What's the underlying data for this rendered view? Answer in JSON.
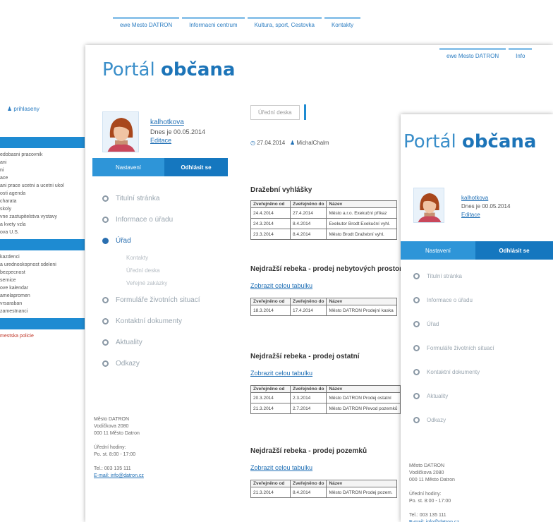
{
  "back_window": {
    "top_nav": [
      "ewe Mesto DATRON",
      "Informacni centrum",
      "Kultura, sport, Cestovka",
      "Kontakty"
    ],
    "user_label": "prihlaseny",
    "left_menu": [
      {
        "type": "bar"
      },
      {
        "type": "line",
        "text": "edobasni pracovnik"
      },
      {
        "type": "line",
        "text": "ani"
      },
      {
        "type": "line",
        "text": "ni"
      },
      {
        "type": "line",
        "text": "ace"
      },
      {
        "type": "line",
        "text": "ani prace ucetni a ucetni ukol"
      },
      {
        "type": "line",
        "text": "osti agenda"
      },
      {
        "type": "line",
        "text": "charata"
      },
      {
        "type": "line",
        "text": "skoly"
      },
      {
        "type": "line",
        "text": "vne zastupitelstva vystavy"
      },
      {
        "type": "line",
        "text": "a kvety vzla"
      },
      {
        "type": "line",
        "text": "ova U.S."
      },
      {
        "type": "bar"
      },
      {
        "type": "line",
        "text": "kazdenci"
      },
      {
        "type": "line",
        "text": "a urednoskopnost sdeleni"
      },
      {
        "type": "line",
        "text": "bezpecnost"
      },
      {
        "type": "line",
        "text": "sernice"
      },
      {
        "type": "line",
        "text": "ove kalendar"
      },
      {
        "type": "line",
        "text": "amelapromen"
      },
      {
        "type": "line",
        "text": "vrsaraban"
      },
      {
        "type": "line",
        "text": "zamestnanci"
      },
      {
        "type": "bar"
      },
      {
        "type": "line",
        "text": "mestska policie",
        "link": true
      }
    ]
  },
  "portal_title_light": "Portál ",
  "portal_title_bold": "občana",
  "mid_window": {
    "top_nav": [
      "ewe Mesto DATRON",
      "Info"
    ],
    "user": {
      "name": "kalhotkova",
      "date": "Dnes je 00.05.2014",
      "link": "Editace"
    },
    "tabs": {
      "left": "Nastavení",
      "right": "Odhlásit se"
    },
    "nav": [
      {
        "label": "Titulní stránka",
        "active": false
      },
      {
        "label": "Informace o úřadu",
        "active": false
      },
      {
        "label": "Úřad",
        "active": true
      },
      {
        "sub": "Kontakty"
      },
      {
        "sub": "Úřední deska"
      },
      {
        "sub": "Veřejné zakázky"
      },
      {
        "label": "Formuláře životních situací",
        "active": false
      },
      {
        "label": "Kontaktní dokumenty",
        "active": false
      },
      {
        "label": "Aktuality",
        "active": false
      },
      {
        "label": "Odkazy",
        "active": false
      }
    ],
    "address": [
      "Město DATRON",
      "Vodičkova 2080",
      "000 11 Město Datron",
      "",
      "Úřední hodiny:",
      "Po. st. 8:00 - 17:00",
      "",
      "Tel.: 003 135 111",
      "E-mail: info@datron.cz"
    ],
    "address_link": "info@datron.cz",
    "breadcrumb_box": "Úřední deska",
    "meta_date": "27.04.2014",
    "meta_author": "MichalChalm",
    "sections": [
      {
        "title": "Dražební vyhlášky",
        "link": "",
        "headers": [
          "Zveřejněno od",
          "Zveřejněno do",
          "Název"
        ],
        "rows": [
          [
            "24.4.2014",
            "27.4.2014",
            "Město a.r.o. Exekuční příkaz"
          ],
          [
            "24.3.2014",
            "8.4.2014",
            "Exekutor Brodt Exekuční vyhl."
          ],
          [
            "23.3.2014",
            "8.4.2014",
            "Město Brodt Dražební vyhl."
          ]
        ]
      },
      {
        "title": "Nejdražší rebeka - prodej nebytových prostor",
        "link": "Zobrazit celou tabulku",
        "headers": [
          "Zveřejněno od",
          "Zveřejněno do",
          "Název"
        ],
        "rows": [
          [
            "18.3.2014",
            "17.4.2014",
            "Město DATRON Prodejní kaska"
          ]
        ]
      },
      {
        "title": "Nejdražší rebeka - prodej ostatní",
        "link": "Zobrazit celou tabulku",
        "headers": [
          "Zveřejněno od",
          "Zveřejněno do",
          "Název"
        ],
        "rows": [
          [
            "20.3.2014",
            "2.3.2014",
            "Město DATRON Prodej ostatní"
          ],
          [
            "21.3.2014",
            "2.7.2014",
            "Město DATRON Převod pozemků"
          ]
        ]
      },
      {
        "title": "Nejdražší rebeka - prodej pozemků",
        "link": "Zobrazit celou tabulku",
        "headers": [
          "Zveřejněno od",
          "Zveřejněno do",
          "Název"
        ],
        "rows": [
          [
            "21.3.2014",
            "8.4.2014",
            "Město DATRON Prodej pozem."
          ]
        ]
      }
    ]
  },
  "front_window": {
    "user": {
      "name": "kalhotkova",
      "date": "Dnes je 00.05.2014",
      "link": "Editace"
    },
    "tabs": {
      "left": "Nastavení",
      "right": "Odhlásit se"
    },
    "nav": [
      "Titulní stránka",
      "Informace o úřadu",
      "Úřad",
      "Formuláře životních situací",
      "Kontaktní dokumenty",
      "Aktuality",
      "Odkazy"
    ],
    "address": [
      "Město DATRON",
      "Vodičkova 2080",
      "000 11 Město Datron",
      "",
      "Úřední hodiny:",
      "Po. st. 8:00 - 17:00",
      "",
      "Tel.: 003 135 111",
      "E-mail: info@datron.cz"
    ]
  },
  "colors": {
    "accent": "#1e8bd2",
    "title": "#3a8ec9",
    "link": "#1f6fb5"
  }
}
